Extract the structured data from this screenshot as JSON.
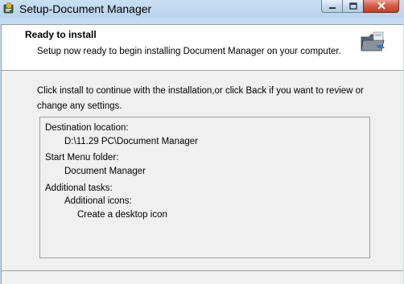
{
  "window": {
    "title": "Setup-Document Manager"
  },
  "header": {
    "title": "Ready to install",
    "subtitle": "Setup now ready to begin installing Document Manager on your computer."
  },
  "intro": {
    "line1": "Click install to continue with the installation,or click Back if you want to review or",
    "line2": "change any settings."
  },
  "memo": {
    "destination_label": "Destination location:",
    "destination_value": "D:\\11.29 PC\\Document Manager",
    "start_menu_label": "Start Menu folder:",
    "start_menu_value": "Document Manager",
    "tasks_label": "Additional tasks:",
    "tasks_group": "Additional icons:",
    "tasks_item": "Create a desktop icon"
  },
  "icons": {
    "app": "setup-app-icon",
    "header": "folder-install-icon",
    "minimize": "minimize-icon",
    "maximize": "maximize-icon",
    "close": "close-icon"
  },
  "colors": {
    "titlebar": "#bad3ec",
    "close_button": "#c43c24",
    "header_bg": "#ffffff",
    "client_bg": "#f0f0f0"
  }
}
